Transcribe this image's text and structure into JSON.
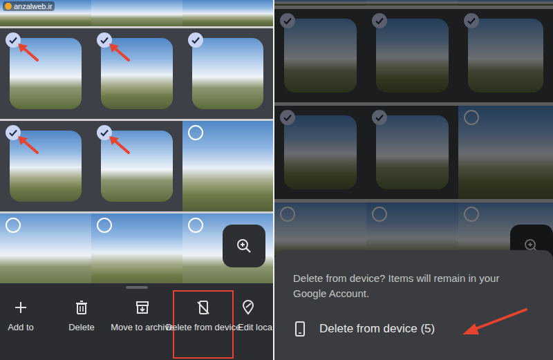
{
  "watermark": "anzalweb.ir",
  "left": {
    "rows": [
      {
        "partial": true,
        "photos": [
          {},
          {},
          {}
        ]
      },
      {
        "partial": false,
        "photos": [
          {
            "selected": true,
            "pointed": true
          },
          {
            "selected": true,
            "pointed": true
          },
          {
            "selected": true,
            "pointed": false
          }
        ]
      },
      {
        "partial": false,
        "photos": [
          {
            "selected": true,
            "pointed": true
          },
          {
            "selected": true,
            "pointed": true
          },
          {
            "selected": false,
            "pointed": false
          }
        ]
      },
      {
        "partial": false,
        "photos": [
          {
            "selected": false,
            "pointed": false
          },
          {
            "selected": false,
            "pointed": false
          },
          {
            "selected": false,
            "pointed": false
          }
        ]
      }
    ],
    "actions": [
      {
        "label": "Add to",
        "highlighted": false
      },
      {
        "label": "Delete",
        "highlighted": false
      },
      {
        "label": "Move to archive",
        "highlighted": false
      },
      {
        "label": "Delete from device",
        "highlighted": true
      },
      {
        "label": "Edit loca",
        "highlighted": false
      }
    ]
  },
  "right": {
    "rows": [
      {
        "partial": true,
        "photos": [
          {},
          {},
          {}
        ]
      },
      {
        "partial": false,
        "photos": [
          {
            "selected": true,
            "pointed": false
          },
          {
            "selected": true,
            "pointed": false
          },
          {
            "selected": true,
            "pointed": false
          }
        ]
      },
      {
        "partial": false,
        "photos": [
          {
            "selected": true,
            "pointed": false
          },
          {
            "selected": true,
            "pointed": false
          },
          {
            "selected": false,
            "pointed": false
          }
        ]
      },
      {
        "partial": false,
        "photos": [
          {
            "selected": false,
            "pointed": false
          },
          {
            "selected": false,
            "pointed": false
          },
          {
            "selected": false,
            "pointed": false
          }
        ]
      }
    ],
    "dialog": {
      "message": "Delete from device? Items will remain in your Google Account.",
      "option": "Delete from device (5)",
      "pointed": true
    }
  }
}
